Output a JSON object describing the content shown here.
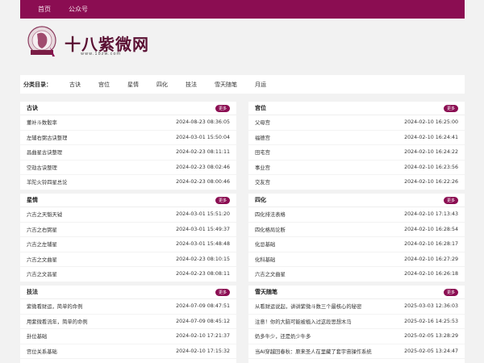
{
  "nav": {
    "items": [
      "首页",
      "公众号"
    ]
  },
  "logo": {
    "title": "十八紫微网",
    "url": "www.18zw.com"
  },
  "categories": {
    "label": "分类目录：",
    "items": [
      "古诀",
      "宫位",
      "星情",
      "四化",
      "技法",
      "雪天随笔",
      "月运"
    ]
  },
  "more_label": "更多",
  "panels": [
    {
      "title": "古诀",
      "rows": [
        {
          "t": "董补斗数骰率",
          "d": "2024-08-23 08:36:05"
        },
        {
          "t": "左辅右弼古诀整理",
          "d": "2024-03-01 15:50:04"
        },
        {
          "t": "昌曲星古诀整理",
          "d": "2024-02-23 08:11:11"
        },
        {
          "t": "空劫古诀整理",
          "d": "2024-02-23 08:02:46"
        },
        {
          "t": "羊陀火铃四星总论",
          "d": "2024-02-23 08:00:46"
        }
      ]
    },
    {
      "title": "宫位",
      "rows": [
        {
          "t": "父母宫",
          "d": "2024-02-10 16:25:00"
        },
        {
          "t": "福德宫",
          "d": "2024-02-10 16:24:41"
        },
        {
          "t": "田宅宫",
          "d": "2024-02-10 16:24:22"
        },
        {
          "t": "事业宫",
          "d": "2024-02-10 16:23:56"
        },
        {
          "t": "交友宫",
          "d": "2024-02-10 16:22:26"
        }
      ]
    },
    {
      "title": "星情",
      "rows": [
        {
          "t": "六吉之天魁天钺",
          "d": "2024-03-01 15:51:20"
        },
        {
          "t": "六吉之右弼星",
          "d": "2024-03-01 15:49:37"
        },
        {
          "t": "六吉之左辅星",
          "d": "2024-03-01 15:48:48"
        },
        {
          "t": "六吉之文曲星",
          "d": "2024-02-23 08:10:15"
        },
        {
          "t": "六吉之文昌星",
          "d": "2024-02-23 08:08:11"
        }
      ]
    },
    {
      "title": "四化",
      "rows": [
        {
          "t": "四化排法表格",
          "d": "2024-02-10 17:13:43"
        },
        {
          "t": "四化格局论断",
          "d": "2024-02-10 16:28:54"
        },
        {
          "t": "化忌基础",
          "d": "2024-02-10 16:28:17"
        },
        {
          "t": "化科基础",
          "d": "2024-02-10 16:27:29"
        },
        {
          "t": "六吉之文曲星",
          "d": "2024-02-10 16:26:18"
        }
      ]
    },
    {
      "title": "技法",
      "rows": [
        {
          "t": "紫微看财运，简单的命例",
          "d": "2024-07-09 08:47:51"
        },
        {
          "t": "用紫微看流年，简单的命例",
          "d": "2024-07-09 08:45:12"
        },
        {
          "t": "卦位基础",
          "d": "2024-02-10 17:21:37"
        },
        {
          "t": "宫位关系基础",
          "d": "2024-02-10 17:15:32"
        }
      ]
    },
    {
      "title": "雪天随笔",
      "rows": [
        {
          "t": "从看财运说起，讲讲紫微斗数三个最核心的秘密",
          "d": "2025-03-03 12:36:03"
        },
        {
          "t": "注意！你的大脑可能被植入过这段思想木马",
          "d": "2025-02-16 14:25:53"
        },
        {
          "t": "奶多牛少，还是奶少牛多",
          "d": "2025-02-05 13:28:29"
        },
        {
          "t": "当AI穿越回春秋：原来圣人在里藏了套宇宙操作系统",
          "d": "2025-02-05 13:24:47"
        }
      ]
    }
  ]
}
